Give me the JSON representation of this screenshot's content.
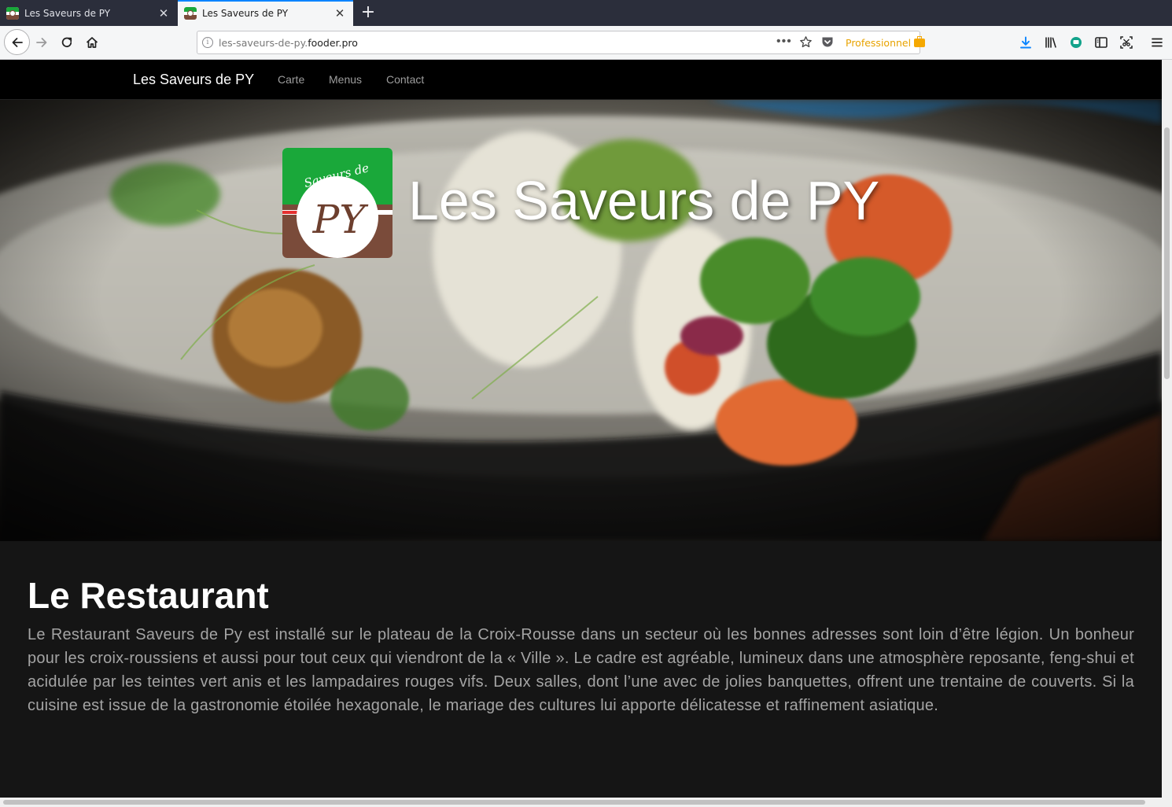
{
  "browser": {
    "tabs": [
      {
        "title": "Les Saveurs de PY",
        "close": "✕",
        "active": false
      },
      {
        "title": "Les Saveurs de PY",
        "close": "✕",
        "active": true
      }
    ],
    "new_tab": "+",
    "url_subdomain": "les-saveurs-de-py.",
    "url_domain": "fooder.pro",
    "url_dots": "•••",
    "container_label": "Professionnel",
    "icons": [
      "back-icon",
      "forward-icon",
      "reload-icon",
      "home-icon",
      "info-icon",
      "star-icon",
      "pocket-icon",
      "download-icon",
      "library-icon",
      "extension-icon",
      "sidebar-icon",
      "screenshot-icon",
      "menu-icon"
    ]
  },
  "site": {
    "brand": "Les Saveurs de PY",
    "nav": [
      {
        "label": "Carte"
      },
      {
        "label": "Menus"
      },
      {
        "label": "Contact"
      }
    ],
    "hero": {
      "title": "Les Saveurs de PY",
      "logo_text_top": "Saveurs de",
      "logo_text_main": "PY"
    },
    "restaurant": {
      "title": "Le Restaurant",
      "text": "Le Restaurant Saveurs de Py est installé sur le plateau de la Croix-Rousse dans un secteur où les bonnes adresses sont loin d’être légion. Un bonheur pour les croix-roussiens et aussi pour tout ceux qui viendront de la « Ville ». Le cadre est agréable, lumineux dans une atmosphère reposante, feng-shui et acidulée par les teintes vert anis et les lampadaires rouges vifs. Deux salles, dont l’une avec de jolies banquettes, offrent une trentaine de couverts. Si la cuisine est issue de la gastronomie étoilée hexagonale, le mariage des cultures lui apporte délicatesse et raffinement asiatique."
    }
  },
  "colors": {
    "tabstrip": "#2b2e3b",
    "toolbar": "#f5f6f7",
    "navbar": "#000000",
    "page_bg": "#151515",
    "logo_green": "#1aa83a",
    "logo_brown": "#7a4b3a",
    "pro_orange": "#e8a300",
    "accent_blue": "#0a84ff"
  }
}
